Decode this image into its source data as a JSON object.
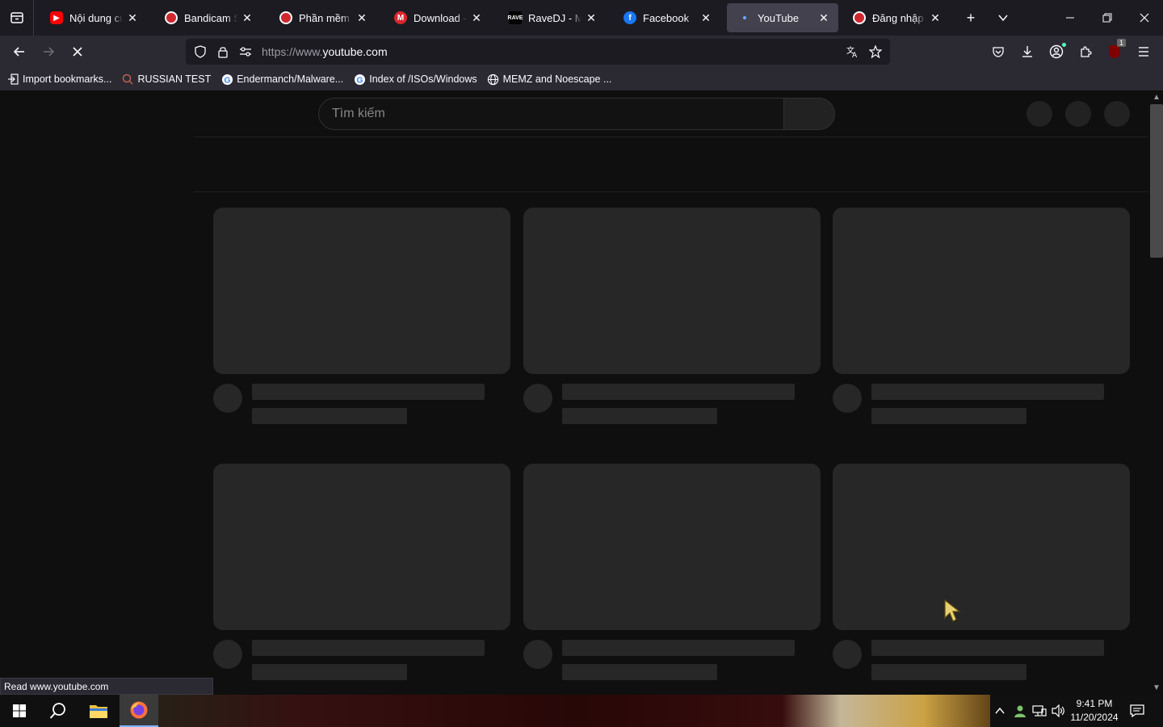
{
  "browser": {
    "tabs": [
      {
        "title": "Nội dung của kênh - YouTube Studio",
        "icon": "youtube-icon",
        "active": false
      },
      {
        "title": "Bandicam Screen Recorder",
        "icon": "bandicam-icon",
        "active": false
      },
      {
        "title": "Phần mềm quay màn hình",
        "icon": "bandicam-icon",
        "active": false
      },
      {
        "title": "Download - MEGA",
        "icon": "mega-icon",
        "active": false
      },
      {
        "title": "RaveDJ - Music Mashups",
        "icon": "ravedj-icon",
        "active": false
      },
      {
        "title": "Facebook",
        "icon": "facebook-icon",
        "active": false
      },
      {
        "title": "YouTube",
        "icon": "loading-dot-icon",
        "active": true
      },
      {
        "title": "Đăng nhập hoàn tất",
        "icon": "bandicam-icon",
        "active": false
      }
    ],
    "url_prefix": "https://www.",
    "url_domain": "youtube.com",
    "bookmarks": [
      {
        "label": "Import bookmarks...",
        "icon": "import-icon"
      },
      {
        "label": "RUSSIAN TEST",
        "icon": "search-bookmark-icon"
      },
      {
        "label": "Endermanch/Malware...",
        "icon": "google-icon"
      },
      {
        "label": "Index of /ISOs/Windows",
        "icon": "google-icon"
      },
      {
        "label": "MEMZ and Noescape ...",
        "icon": "globe-icon"
      }
    ],
    "extension_badge": "1",
    "status_text": "Read www.youtube.com"
  },
  "page": {
    "search_placeholder": "Tìm kiếm"
  },
  "taskbar": {
    "time": "9:41 PM",
    "date": "11/20/2024"
  },
  "colors": {
    "youtube_red": "#ff0000",
    "facebook_blue": "#1877f2",
    "mega_red": "#d9272e",
    "skeleton": "#272727",
    "browser_bg": "#2b2a33"
  }
}
